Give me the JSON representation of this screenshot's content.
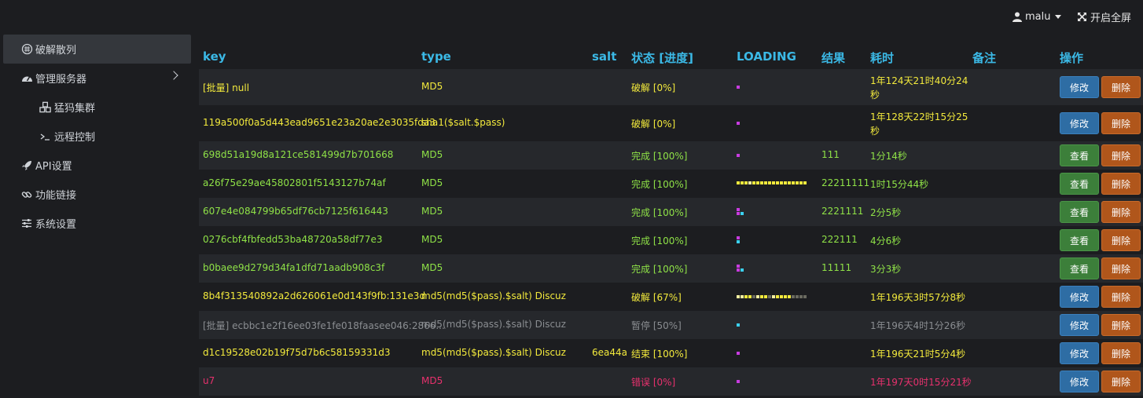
{
  "topbar": {
    "user_name": "malu",
    "fullscreen_label": "开启全屏"
  },
  "sidebar": {
    "items": [
      {
        "label": "破解散列",
        "icon": "hash-icon"
      },
      {
        "label": "管理服务器",
        "icon": "dashboard-icon"
      },
      {
        "label": "猛犸集群",
        "icon": "cubes-icon"
      },
      {
        "label": "远程控制",
        "icon": "terminal-icon"
      },
      {
        "label": "API设置",
        "icon": "rocket-icon"
      },
      {
        "label": "功能链接",
        "icon": "link-icon"
      },
      {
        "label": "系统设置",
        "icon": "sliders-icon"
      }
    ]
  },
  "table": {
    "headers": [
      "key",
      "type",
      "salt",
      "状态 [进度]",
      "LOADING",
      "结果",
      "耗时",
      "备注",
      "操作"
    ],
    "buttons": {
      "edit": "修改",
      "view": "查看",
      "delete": "删除"
    },
    "rows": [
      {
        "key": "[批量] null",
        "type": "MD5",
        "salt": "",
        "status": "破解 [0%]",
        "result": "",
        "time_line1": "1年124天21时40分24",
        "time_line2": "秒",
        "action": "修改",
        "color": "yellow",
        "loading": "one-purple"
      },
      {
        "key": "119a500f0a5d443ead9651e23a20ae2e3035fda3",
        "type": "sha1($salt.$pass)",
        "salt": "",
        "status": "破解 [0%]",
        "result": "",
        "time_line1": "1年128天22时15分25",
        "time_line2": "秒",
        "action": "修改",
        "color": "yellow",
        "loading": "one-purple"
      },
      {
        "key": "698d51a19d8a121ce581499d7b701668",
        "type": "MD5",
        "salt": "",
        "status": "完成 [100%]",
        "result": "111",
        "time_line1": "1分14秒",
        "time_line2": "",
        "action": "查看",
        "color": "green",
        "loading": "one-purple"
      },
      {
        "key": "a26f75e29ae45802801f5143127b74af",
        "type": "MD5",
        "salt": "",
        "status": "完成 [100%]",
        "result": "22211111",
        "time_line1": "1时15分44秒",
        "time_line2": "",
        "action": "查看",
        "color": "green",
        "loading": "bar-long"
      },
      {
        "key": "607e4e084799b65df76cb7125f616443",
        "type": "MD5",
        "salt": "",
        "status": "完成 [100%]",
        "result": "2221111",
        "time_line1": "2分5秒",
        "time_line2": "",
        "action": "查看",
        "color": "green",
        "loading": "stack-a"
      },
      {
        "key": "0276cbf4fbfedd53ba48720a58df77e3",
        "type": "MD5",
        "salt": "",
        "status": "完成 [100%]",
        "result": "222111",
        "time_line1": "4分6秒",
        "time_line2": "",
        "action": "查看",
        "color": "green",
        "loading": "stack-b"
      },
      {
        "key": "b0baee9d279d34fa1dfd71aadb908c3f",
        "type": "MD5",
        "salt": "",
        "status": "完成 [100%]",
        "result": "11111",
        "time_line1": "3分3秒",
        "time_line2": "",
        "action": "查看",
        "color": "green",
        "loading": "stack-c"
      },
      {
        "key": "8b4f313540892a2d626061e0d143f9fb:131e3d",
        "type": "md5(md5($pass).$salt) Discuz",
        "salt": "",
        "status": "破解 [67%]",
        "result": "",
        "time_line1": "1年196天3时57分8秒",
        "time_line2": "",
        "action": "修改",
        "color": "yellow",
        "loading": "bar-mid"
      },
      {
        "key": "[批量] ecbbc1e2f16ee03fe1fe018faasee046:2866...",
        "type": "md5(md5($pass).$salt) Discuz",
        "salt": "",
        "status": "暂停 [50%]",
        "result": "",
        "time_line1": "1年196天4时1分26秒",
        "time_line2": "",
        "action": "修改",
        "color": "gray",
        "loading": "one-cyan"
      },
      {
        "key": "d1c19528e02b19f75d7b6c58159331d3",
        "type": "md5(md5($pass).$salt) Discuz",
        "salt": "6ea44a",
        "status": "结束 [100%]",
        "result": "",
        "time_line1": "1年196天21时5分4秒",
        "time_line2": "",
        "action": "修改",
        "color": "yellow",
        "loading": "one-purple"
      },
      {
        "key": "u7",
        "type": "MD5",
        "salt": "",
        "status": "错误 [0%]",
        "result": "",
        "time_line1": "1年197天0时15分21秒",
        "time_line2": "",
        "action": "修改",
        "color": "red",
        "loading": "one-purple"
      }
    ]
  },
  "colors": {
    "header": "#3bb9e6",
    "yellow": "#f3ea3c",
    "green": "#8fe247",
    "gray": "#8a8d91",
    "red": "#e8316e",
    "purple": "#c83ce0",
    "cyan": "#3bd0f0"
  }
}
